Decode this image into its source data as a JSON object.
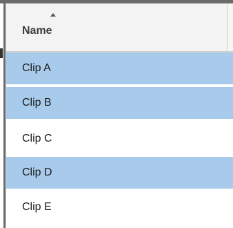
{
  "grid": {
    "column_header": "Name",
    "sort_direction": "ascending",
    "selection_color": "#a8cbeb",
    "rows": [
      {
        "label": "Clip A",
        "selected": true
      },
      {
        "label": "Clip B",
        "selected": true
      },
      {
        "label": "Clip C",
        "selected": false
      },
      {
        "label": "Clip D",
        "selected": true
      },
      {
        "label": "Clip E",
        "selected": false
      }
    ]
  }
}
